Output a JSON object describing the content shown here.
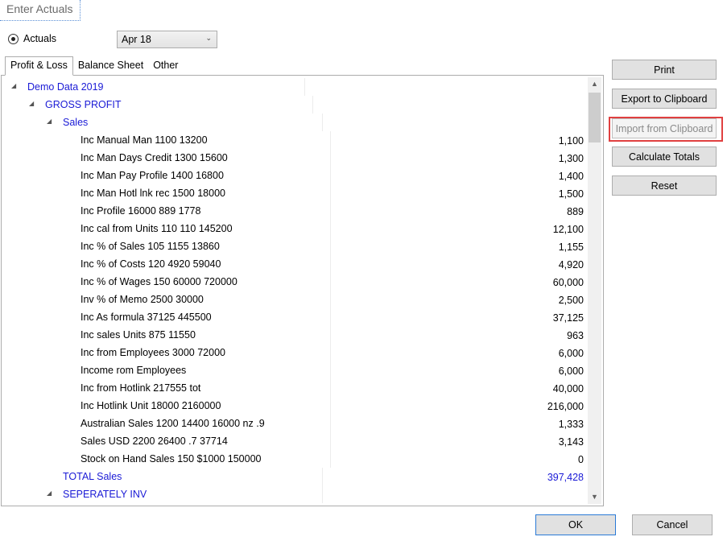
{
  "window": {
    "title": "Enter Actuals"
  },
  "mode": {
    "radio_label": "Actuals",
    "period": "Apr 18"
  },
  "tabs": [
    "Profit & Loss",
    "Balance Sheet",
    "Other"
  ],
  "tree": {
    "root": "Demo Data 2019",
    "group": "GROSS PROFIT",
    "section": "Sales",
    "items": [
      {
        "label": "Inc Manual Man 1100 13200",
        "value": "1,100"
      },
      {
        "label": "Inc Man Days Credit 1300 15600",
        "value": "1,300"
      },
      {
        "label": "Inc Man Pay Profile 1400 16800",
        "value": "1,400"
      },
      {
        "label": "Inc Man Hotl lnk rec 1500 18000",
        "value": "1,500"
      },
      {
        "label": "Inc Profile 16000 889 1778",
        "value": "889"
      },
      {
        "label": "Inc cal from Units 110 110 145200",
        "value": "12,100"
      },
      {
        "label": "Inc % of Sales 105 1155 13860",
        "value": "1,155"
      },
      {
        "label": "Inc % of Costs 120 4920 59040",
        "value": "4,920"
      },
      {
        "label": "Inc % of Wages 150 60000 720000",
        "value": "60,000"
      },
      {
        "label": "Inv % of Memo 2500 30000",
        "value": "2,500"
      },
      {
        "label": "Inc As formula  37125 445500",
        "value": "37,125"
      },
      {
        "label": "Inc sales Units 875 11550",
        "value": "963"
      },
      {
        "label": "Inc from Employees 3000 72000",
        "value": "6,000"
      },
      {
        "label": "Income rom Employees",
        "value": "6,000"
      },
      {
        "label": "Inc from Hotlink 217555 tot",
        "value": "40,000"
      },
      {
        "label": "Inc Hotlink Unit 18000 2160000",
        "value": "216,000"
      },
      {
        "label": "Australian Sales 1200 14400 16000 nz .9",
        "value": "1,333"
      },
      {
        "label": "Sales USD 2200 26400 .7 37714",
        "value": "3,143"
      },
      {
        "label": "Stock on Hand Sales 150 $1000 150000",
        "value": "0"
      }
    ],
    "total": {
      "label": "TOTAL Sales",
      "value": "397,428"
    },
    "next_section": "SEPERATELY INV"
  },
  "side_buttons": {
    "print": "Print",
    "export": "Export to Clipboard",
    "import": "Import from Clipboard",
    "calculate": "Calculate Totals",
    "reset": "Reset"
  },
  "footer": {
    "ok": "OK",
    "cancel": "Cancel"
  }
}
